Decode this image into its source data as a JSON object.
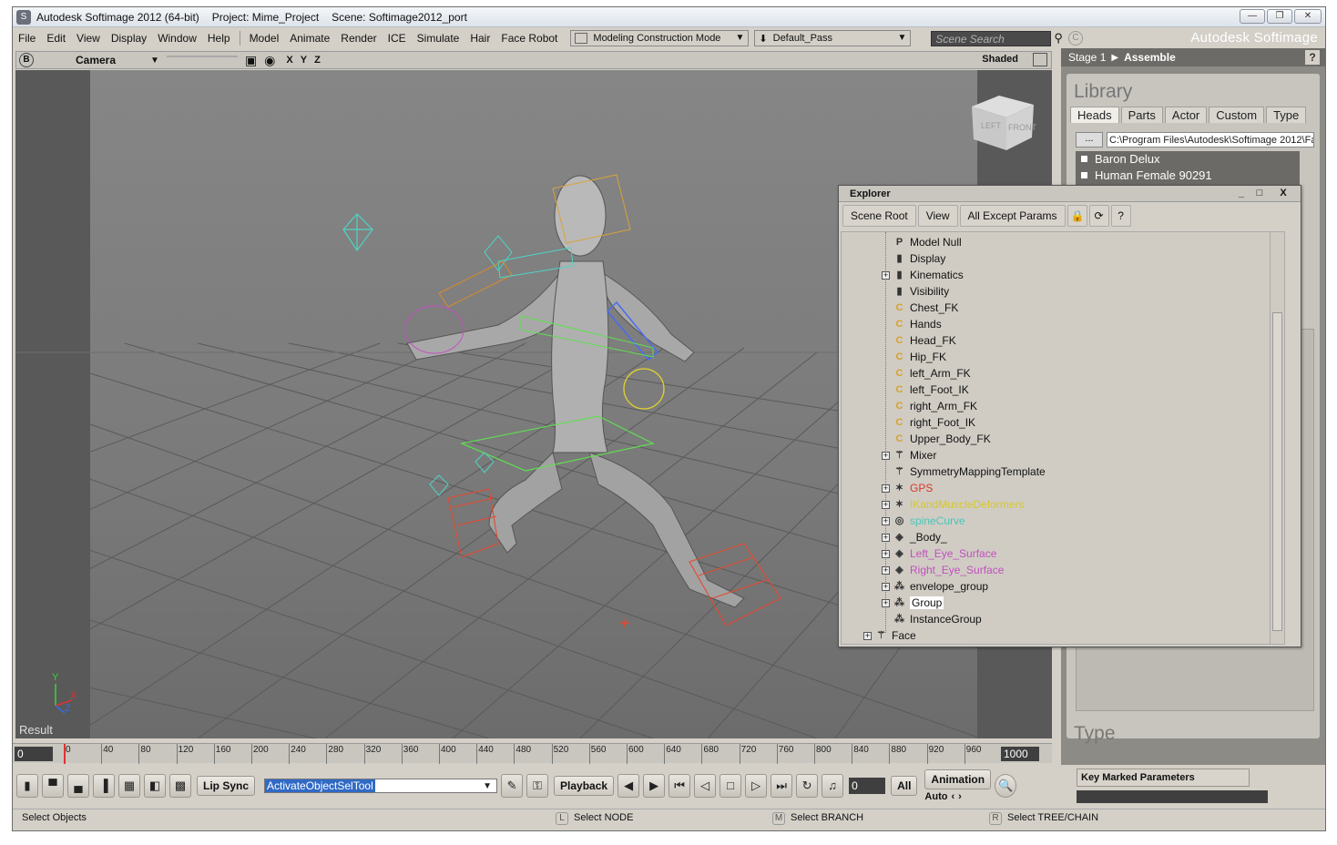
{
  "window": {
    "title": "Autodesk Softimage 2012 (64-bit)",
    "project": "Project: Mime_Project",
    "scene": "Scene: Softimage2012_port",
    "buttons": {
      "minimize": "—",
      "maximize": "❐",
      "close": "✕"
    }
  },
  "menubar": {
    "items": [
      "File",
      "Edit",
      "View",
      "Display",
      "Window",
      "Help"
    ],
    "modules": [
      "Model",
      "Animate",
      "Render",
      "ICE",
      "Simulate",
      "Hair",
      "Face Robot"
    ],
    "mode_dropdown": "Modeling Construction Mode",
    "pass_dropdown": "Default_Pass",
    "scene_search_placeholder": "Scene Search",
    "brand": "Autodesk Softimage"
  },
  "viewport": {
    "header_label": "B",
    "camera": "Camera",
    "axes": [
      "X",
      "Y",
      "Z"
    ],
    "display_mode": "Shaded",
    "result_label": "Result",
    "cube_faces": {
      "left": "LEFT",
      "front": "FRONT"
    },
    "axis_gizmo": {
      "y": "Y",
      "x": "X",
      "z": "Z"
    }
  },
  "right_panel": {
    "stage": "Stage 1",
    "section": "Assemble",
    "help": "?",
    "library_title": "Library",
    "tabs": [
      "Heads",
      "Parts",
      "Actor",
      "Custom",
      "Type"
    ],
    "active_tab": "Heads",
    "path_button": "...",
    "path": "C:\\Program Files\\Autodesk\\Softimage 2012\\Fa",
    "items": [
      "Baron Delux",
      "Human Female 90291"
    ],
    "type_title": "Type"
  },
  "explorer": {
    "title": "Explorer",
    "window_buttons": {
      "min": "_",
      "max": "□",
      "close": "X"
    },
    "tools": [
      "Scene Root",
      "View",
      "All Except Params"
    ],
    "tree": [
      {
        "label": "Model Null",
        "icon": "model-null-icon",
        "glyph": "P",
        "expand": false,
        "color": "#111111"
      },
      {
        "label": "Display",
        "icon": "property-icon",
        "glyph": "▮",
        "expand": false,
        "color": "#111111"
      },
      {
        "label": "Kinematics",
        "icon": "property-icon",
        "glyph": "▮",
        "expand": true,
        "color": "#111111"
      },
      {
        "label": "Visibility",
        "icon": "property-icon",
        "glyph": "▮",
        "expand": false,
        "color": "#111111"
      },
      {
        "label": "Chest_FK",
        "icon": "character-key-set-icon",
        "glyph": "C",
        "expand": false,
        "color": "#111111"
      },
      {
        "label": "Hands",
        "icon": "character-key-set-icon",
        "glyph": "C",
        "expand": false,
        "color": "#111111"
      },
      {
        "label": "Head_FK",
        "icon": "character-key-set-icon",
        "glyph": "C",
        "expand": false,
        "color": "#111111"
      },
      {
        "label": "Hip_FK",
        "icon": "character-key-set-icon",
        "glyph": "C",
        "expand": false,
        "color": "#111111"
      },
      {
        "label": "left_Arm_FK",
        "icon": "character-key-set-icon",
        "glyph": "C",
        "expand": false,
        "color": "#111111"
      },
      {
        "label": "left_Foot_IK",
        "icon": "character-key-set-icon",
        "glyph": "C",
        "expand": false,
        "color": "#111111"
      },
      {
        "label": "right_Arm_FK",
        "icon": "character-key-set-icon",
        "glyph": "C",
        "expand": false,
        "color": "#111111"
      },
      {
        "label": "right_Foot_IK",
        "icon": "character-key-set-icon",
        "glyph": "C",
        "expand": false,
        "color": "#111111"
      },
      {
        "label": "Upper_Body_FK",
        "icon": "character-key-set-icon",
        "glyph": "C",
        "expand": false,
        "color": "#111111"
      },
      {
        "label": "Mixer",
        "icon": "mixer-icon",
        "glyph": "⚚",
        "expand": true,
        "color": "#111111"
      },
      {
        "label": "SymmetryMappingTemplate",
        "icon": "template-icon",
        "glyph": "⚚",
        "expand": false,
        "color": "#111111"
      },
      {
        "label": "GPS",
        "icon": "null-icon",
        "glyph": "✶",
        "expand": true,
        "color": "#d63a2a"
      },
      {
        "label": "IKandMuscleDeformers",
        "icon": "null-icon",
        "glyph": "✶",
        "expand": true,
        "color": "#d7c72a"
      },
      {
        "label": "spineCurve",
        "icon": "curve-icon",
        "glyph": "◎",
        "expand": true,
        "color": "#49c6b9"
      },
      {
        "label": "_Body_",
        "icon": "polymesh-icon",
        "glyph": "◈",
        "expand": true,
        "color": "#111111"
      },
      {
        "label": "Left_Eye_Surface",
        "icon": "surface-icon",
        "glyph": "◈",
        "expand": true,
        "color": "#c24fc0"
      },
      {
        "label": "Right_Eye_Surface",
        "icon": "surface-icon",
        "glyph": "◈",
        "expand": true,
        "color": "#c24fc0"
      },
      {
        "label": "envelope_group",
        "icon": "group-icon",
        "glyph": "⁂",
        "expand": true,
        "color": "#111111"
      },
      {
        "label": "Group",
        "icon": "group-icon",
        "glyph": "⁂",
        "expand": true,
        "color": "#111111",
        "selected": true
      },
      {
        "label": "InstanceGroup",
        "icon": "group-icon",
        "glyph": "⁂",
        "expand": false,
        "color": "#111111"
      },
      {
        "label": "Face",
        "icon": "model-icon",
        "glyph": "⚚",
        "expand": true,
        "color": "#111111",
        "depth": 0
      }
    ]
  },
  "timeline": {
    "start": "0",
    "end": "1000",
    "ticks": [
      "0",
      "40",
      "80",
      "120",
      "160",
      "200",
      "240",
      "280",
      "320",
      "360",
      "400",
      "440",
      "480",
      "520",
      "560",
      "600",
      "640",
      "680",
      "720",
      "760",
      "800",
      "840",
      "880",
      "920",
      "960"
    ]
  },
  "bottombar": {
    "lip_sync": "Lip Sync",
    "tool": "ActivateObjectSelTool",
    "playback": "Playback",
    "frame": "0",
    "all": "All",
    "animation": "Animation",
    "auto": "Auto",
    "key_marked": "Key Marked Parameters"
  },
  "statusbar": {
    "left": "Select Objects",
    "l_key": "L",
    "l_text": "Select NODE",
    "m_key": "M",
    "m_text": "Select BRANCH",
    "r_key": "R",
    "r_text": "Select TREE/CHAIN"
  }
}
